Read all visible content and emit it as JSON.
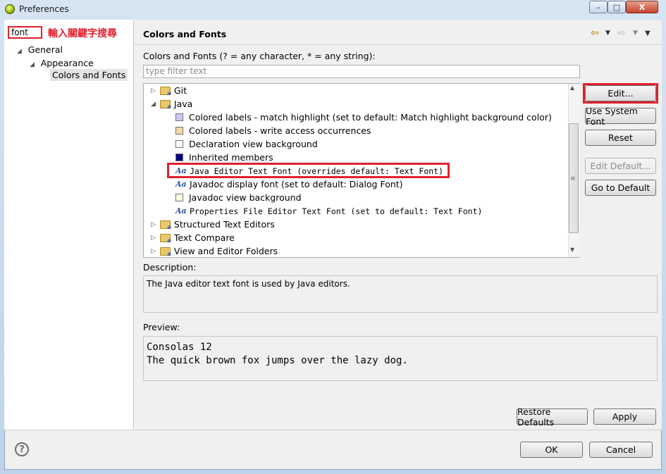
{
  "window": {
    "title": "Preferences",
    "controls": [
      "–",
      "□",
      "X"
    ]
  },
  "sidebar": {
    "search_value": "font",
    "search_annotation": "輸入關鍵字搜尋",
    "tree": [
      {
        "label": "General",
        "expanded": true,
        "level": 0
      },
      {
        "label": "Appearance",
        "expanded": true,
        "level": 1
      },
      {
        "label": "Colors and Fonts",
        "selected": true,
        "level": 2
      }
    ],
    "help_label": "?"
  },
  "page": {
    "title": "Colors and Fonts",
    "filter_label": "Colors and Fonts (? = any character, * = any string):",
    "filter_placeholder": "type filter text",
    "nav_icons": [
      "back-arrow-icon",
      "forward-arrow-icon",
      "view-menu-icon"
    ],
    "tree": [
      {
        "label": "Git",
        "kind": "folder",
        "expanded": false
      },
      {
        "label": "Java",
        "kind": "folder",
        "expanded": true
      },
      {
        "label": "Colored labels - match highlight (set to default: Match highlight background color)",
        "kind": "color",
        "swatch": "#c8c8f0"
      },
      {
        "label": "Colored labels - write access occurrences",
        "kind": "color",
        "swatch": "#f5d8a8"
      },
      {
        "label": "Declaration view background",
        "kind": "color",
        "swatch": "#ffffff"
      },
      {
        "label": "Inherited members",
        "kind": "color",
        "swatch": "#000080"
      },
      {
        "label": "Java Editor Text Font (overrides default: Text Font)",
        "kind": "font",
        "mono": true,
        "highlighted": true
      },
      {
        "label": "Javadoc display font (set to default: Dialog Font)",
        "kind": "font"
      },
      {
        "label": "Javadoc view background",
        "kind": "color",
        "swatch": "#ffffe1"
      },
      {
        "label": "Properties File Editor Text Font (set to default: Text Font)",
        "kind": "font",
        "mono": true
      },
      {
        "label": "Structured Text Editors",
        "kind": "folder",
        "expanded": false
      },
      {
        "label": "Text Compare",
        "kind": "folder",
        "expanded": false
      },
      {
        "label": "View and Editor Folders",
        "kind": "folder",
        "expanded": false
      }
    ],
    "buttons": {
      "edit": "Edit...",
      "use_system_font": "Use System Font",
      "reset": "Reset",
      "edit_default": "Edit Default...",
      "go_to_default": "Go to Default"
    },
    "description_label": "Description:",
    "description_text": "The Java editor text font is used by Java editors.",
    "preview_label": "Preview:",
    "preview_line1": "Consolas 12",
    "preview_line2": "The quick brown fox jumps over the lazy dog.",
    "restore_defaults": "Restore Defaults",
    "apply": "Apply"
  },
  "footer": {
    "ok": "OK",
    "cancel": "Cancel"
  },
  "colors": {
    "annotation_red": "#e0202c",
    "selection_gray": "#e4e4e4"
  }
}
